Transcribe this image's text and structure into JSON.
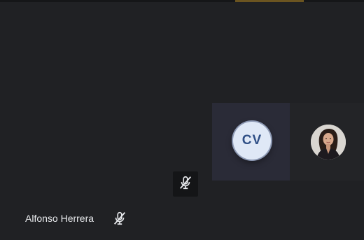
{
  "main_participant": {
    "name": "Alfonso Herrera",
    "mic_icon": "mic-off-icon"
  },
  "self_tile": {
    "mic_icon": "mic-off-icon"
  },
  "participants": [
    {
      "initials": "CV",
      "avatar_color": "#dfe8f6",
      "tile_color": "#2a2b37"
    },
    {
      "avatar": "profile-photo"
    }
  ],
  "colors": {
    "background": "#202124",
    "accent": "#6b5420",
    "text": "#e8eaed"
  }
}
